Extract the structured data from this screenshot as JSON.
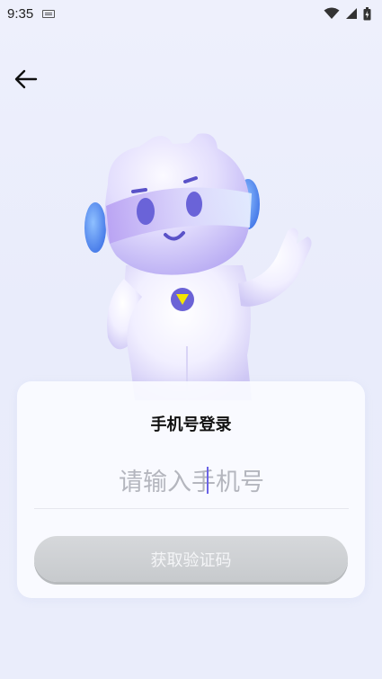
{
  "status_bar": {
    "time": "9:35",
    "icons": [
      "keyboard-icon",
      "wifi-icon",
      "signal-icon",
      "battery-icon"
    ]
  },
  "nav": {
    "back_icon": "arrow-left-icon"
  },
  "login": {
    "title": "手机号登录",
    "phone_placeholder": "请输入手机号",
    "phone_value": "",
    "get_code_label": "获取验证码"
  },
  "colors": {
    "background": "#ebeefb",
    "accent": "#6a63e6",
    "button_disabled": "#cdd0d3",
    "mascot_badge": "#f5e600"
  }
}
